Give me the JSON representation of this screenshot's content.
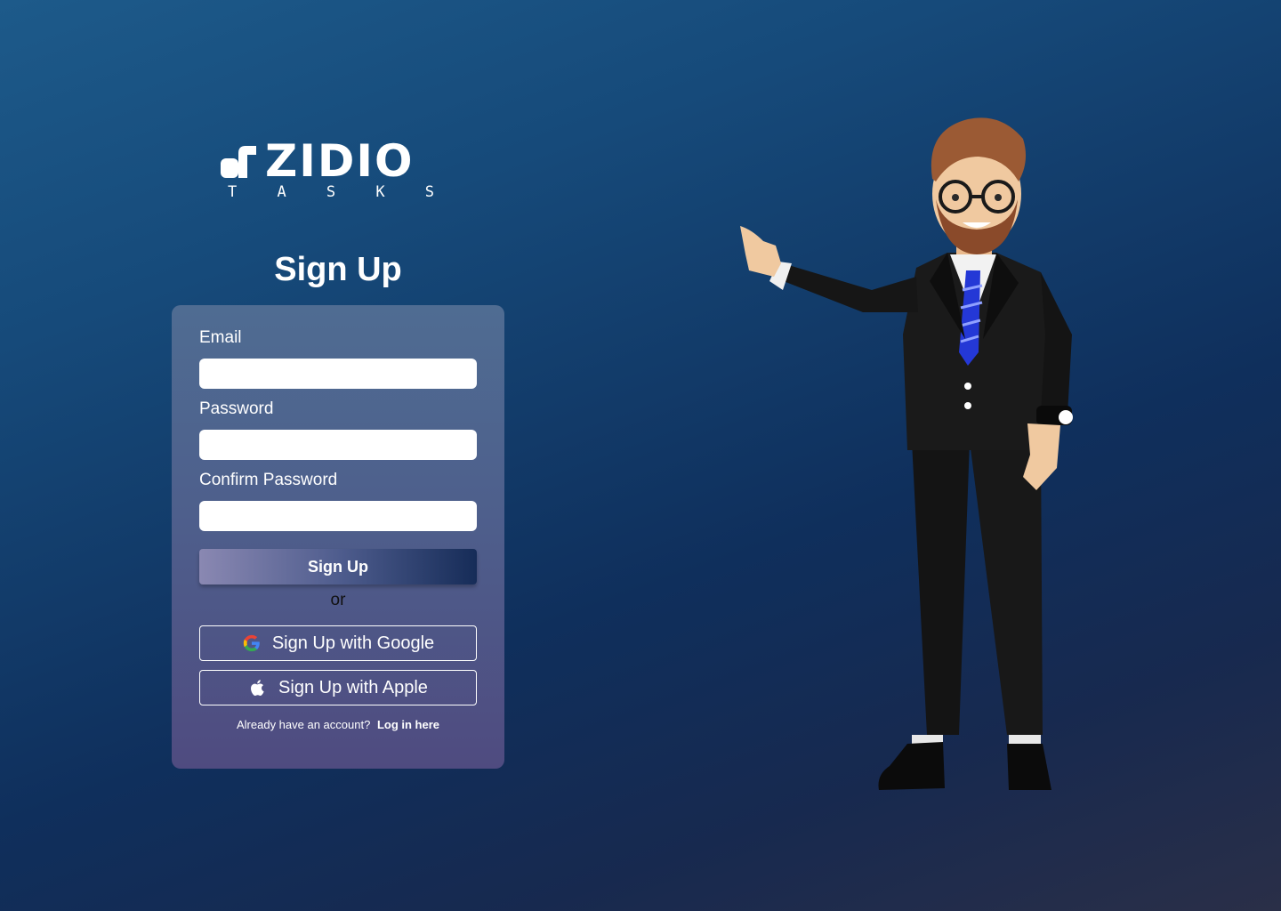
{
  "brand": {
    "name": "ZIDIO",
    "sub_letters": [
      "T",
      "A",
      "S",
      "K",
      "S"
    ]
  },
  "page": {
    "title": "Sign Up"
  },
  "form": {
    "email_label": "Email",
    "email_value": "",
    "password_label": "Password",
    "password_value": "",
    "confirm_label": "Confirm Password",
    "confirm_value": "",
    "submit_label": "Sign Up",
    "or_text": "or",
    "google_label": "Sign Up with Google",
    "apple_label": "Sign Up with Apple",
    "login_prompt": "Already have an account?",
    "login_link": "Log in here"
  },
  "icons": {
    "google": "google-icon",
    "apple": "apple-icon"
  },
  "colors": {
    "background_start": "#1d5a8a",
    "background_end": "#2a2f48",
    "card": "#4f5d8e",
    "button_gradient_end": "#162c58"
  }
}
